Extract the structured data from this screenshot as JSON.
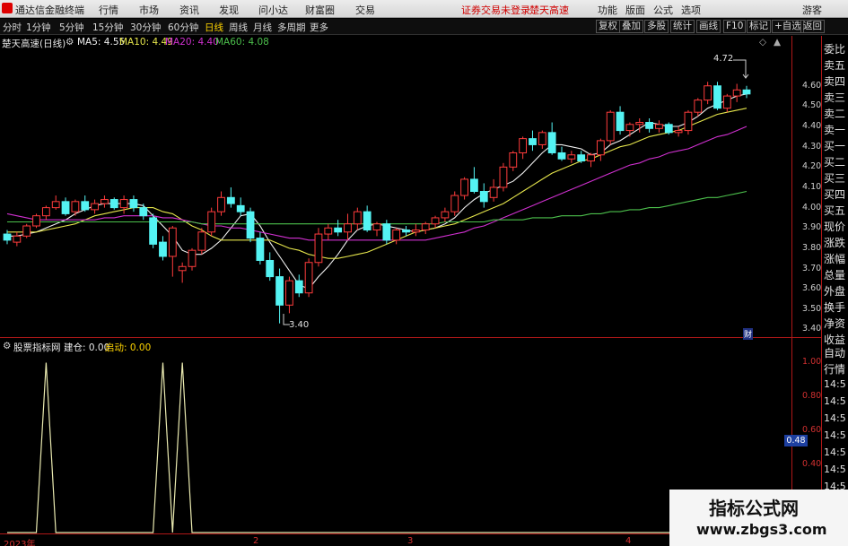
{
  "menubar": {
    "app_title": "通达信金融终端",
    "items": [
      "行情",
      "市场",
      "资讯",
      "发现",
      "问小达",
      "财富圈",
      "交易"
    ],
    "warning": "证券交易未登录",
    "stock": "楚天高速",
    "right_items": [
      "功能",
      "版面",
      "公式",
      "选项"
    ],
    "user": "游客"
  },
  "toolbar": {
    "periods": [
      "分时",
      "1分钟",
      "5分钟",
      "15分钟",
      "30分钟",
      "60分钟",
      "日线",
      "周线",
      "月线",
      "多周期",
      "更多"
    ],
    "selected_period": "日线",
    "buttons": [
      "复权",
      "叠加",
      "多股",
      "统计",
      "画线",
      "F10",
      "标记",
      "+自选",
      "返回"
    ]
  },
  "main_chart": {
    "stock_name": "楚天高速",
    "period": "(日线)",
    "ma5": "MA5: 4.55",
    "ma10": "MA10: 4.49",
    "ma20": "MA20: 4.40",
    "ma60": "MA60: 4.08",
    "high_label": "4.72",
    "low_label": "3.40",
    "cai_icon": "财"
  },
  "sub_chart": {
    "name": "股票指标网",
    "build": "建仓: 0.00",
    "start": "启动: 0.00",
    "current_value": "0.48"
  },
  "right_panel": {
    "labels": [
      "委比",
      "卖五",
      "卖四",
      "卖三",
      "卖二",
      "卖一",
      "买一",
      "买二",
      "买三",
      "买四",
      "买五",
      "现价",
      "涨跌",
      "涨幅",
      "总量",
      "外盘",
      "换手",
      "净资",
      "收益"
    ],
    "lower_labels": [
      "自动",
      "行情"
    ],
    "times": [
      "14:5",
      "14:5",
      "14:5",
      "14:5",
      "14:5",
      "14:5",
      "14:5",
      "14:5",
      "14:5",
      "14:5"
    ]
  },
  "x_labels": [
    "2023年",
    "2",
    "3",
    "4"
  ],
  "watermark": {
    "line1": "指标公式网",
    "line2": "www.zbgs3.com"
  },
  "colors": {
    "up": "#ff3c3c",
    "down": "#54f3f3",
    "ma5": "#f0f0f0",
    "ma10": "#e6e64c",
    "ma20": "#d030d0",
    "ma60": "#4cc04c",
    "sub_line": "#eaeab0"
  },
  "chart_data": [
    {
      "type": "candlestick",
      "title": "楚天高速 (日线)",
      "y_ticks": [
        4.6,
        4.5,
        4.4,
        4.3,
        4.2,
        4.1,
        4.0,
        3.9,
        3.8,
        3.7,
        3.6,
        3.5,
        3.4
      ],
      "ylim": [
        3.38,
        4.78
      ],
      "ohlc": [
        [
          3.87,
          3.89,
          3.82,
          3.84
        ],
        [
          3.83,
          3.88,
          3.81,
          3.86
        ],
        [
          3.86,
          3.92,
          3.85,
          3.91
        ],
        [
          3.91,
          3.97,
          3.9,
          3.96
        ],
        [
          3.96,
          4.01,
          3.94,
          4.0
        ],
        [
          4.0,
          4.06,
          3.99,
          4.03
        ],
        [
          4.03,
          4.05,
          3.96,
          3.97
        ],
        [
          3.98,
          4.04,
          3.96,
          4.03
        ],
        [
          4.03,
          4.06,
          3.98,
          3.99
        ],
        [
          3.99,
          4.04,
          3.97,
          4.02
        ],
        [
          4.02,
          4.06,
          4.0,
          4.04
        ],
        [
          4.04,
          4.05,
          3.99,
          4.0
        ],
        [
          4.0,
          4.06,
          3.97,
          4.04
        ],
        [
          4.04,
          4.06,
          3.98,
          4.0
        ],
        [
          4.0,
          4.02,
          3.94,
          3.96
        ],
        [
          3.95,
          3.97,
          3.8,
          3.82
        ],
        [
          3.83,
          3.86,
          3.74,
          3.76
        ],
        [
          3.76,
          3.91,
          3.66,
          3.9
        ],
        [
          3.69,
          3.73,
          3.63,
          3.71
        ],
        [
          3.71,
          3.8,
          3.69,
          3.79
        ],
        [
          3.79,
          3.9,
          3.77,
          3.88
        ],
        [
          3.88,
          4.0,
          3.86,
          3.98
        ],
        [
          3.98,
          4.08,
          3.96,
          4.05
        ],
        [
          4.05,
          4.1,
          4.0,
          4.02
        ],
        [
          4.01,
          4.05,
          3.96,
          3.98
        ],
        [
          3.98,
          4.0,
          3.83,
          3.85
        ],
        [
          3.85,
          3.88,
          3.72,
          3.74
        ],
        [
          3.74,
          3.78,
          3.64,
          3.66
        ],
        [
          3.66,
          3.7,
          3.43,
          3.52
        ],
        [
          3.52,
          3.66,
          3.48,
          3.64
        ],
        [
          3.64,
          3.67,
          3.56,
          3.58
        ],
        [
          3.58,
          3.75,
          3.56,
          3.73
        ],
        [
          3.73,
          3.9,
          3.71,
          3.87
        ],
        [
          3.87,
          3.92,
          3.84,
          3.9
        ],
        [
          3.9,
          3.94,
          3.86,
          3.88
        ],
        [
          3.88,
          3.97,
          3.84,
          3.92
        ],
        [
          3.92,
          4.0,
          3.89,
          3.98
        ],
        [
          3.98,
          4.01,
          3.88,
          3.89
        ],
        [
          3.89,
          3.93,
          3.86,
          3.92
        ],
        [
          3.92,
          3.94,
          3.82,
          3.84
        ],
        [
          3.84,
          3.9,
          3.82,
          3.89
        ],
        [
          3.89,
          3.91,
          3.86,
          3.88
        ],
        [
          3.88,
          3.92,
          3.86,
          3.89
        ],
        [
          3.89,
          3.93,
          3.87,
          3.92
        ],
        [
          3.92,
          3.96,
          3.9,
          3.95
        ],
        [
          3.95,
          4.0,
          3.93,
          3.98
        ],
        [
          3.98,
          4.08,
          3.96,
          4.06
        ],
        [
          4.06,
          4.15,
          4.04,
          4.14
        ],
        [
          4.14,
          4.2,
          4.07,
          4.08
        ],
        [
          4.08,
          4.12,
          4.0,
          4.03
        ],
        [
          4.05,
          4.14,
          4.03,
          4.1
        ],
        [
          4.1,
          4.22,
          4.08,
          4.2
        ],
        [
          4.2,
          4.28,
          4.18,
          4.27
        ],
        [
          4.27,
          4.35,
          4.24,
          4.34
        ],
        [
          4.34,
          4.38,
          4.28,
          4.31
        ],
        [
          4.31,
          4.38,
          4.29,
          4.37
        ],
        [
          4.37,
          4.42,
          4.26,
          4.27
        ],
        [
          4.27,
          4.3,
          4.23,
          4.24
        ],
        [
          4.24,
          4.28,
          4.22,
          4.26
        ],
        [
          4.26,
          4.28,
          4.22,
          4.23
        ],
        [
          4.23,
          4.27,
          4.2,
          4.26
        ],
        [
          4.26,
          4.34,
          4.23,
          4.33
        ],
        [
          4.33,
          4.48,
          4.31,
          4.47
        ],
        [
          4.47,
          4.5,
          4.36,
          4.38
        ],
        [
          4.38,
          4.42,
          4.35,
          4.41
        ],
        [
          4.41,
          4.44,
          4.37,
          4.42
        ],
        [
          4.42,
          4.44,
          4.37,
          4.39
        ],
        [
          4.39,
          4.43,
          4.37,
          4.41
        ],
        [
          4.41,
          4.42,
          4.36,
          4.37
        ],
        [
          4.37,
          4.4,
          4.35,
          4.38
        ],
        [
          4.38,
          4.48,
          4.36,
          4.47
        ],
        [
          4.47,
          4.54,
          4.45,
          4.53
        ],
        [
          4.53,
          4.62,
          4.51,
          4.6
        ],
        [
          4.6,
          4.62,
          4.48,
          4.49
        ],
        [
          4.49,
          4.56,
          4.47,
          4.55
        ],
        [
          4.55,
          4.61,
          4.52,
          4.58
        ],
        [
          4.58,
          4.6,
          4.54,
          4.56
        ]
      ],
      "series": [
        {
          "name": "MA5",
          "color": "#f0f0f0",
          "values": [
            3.86,
            3.86,
            3.87,
            3.88,
            3.9,
            3.92,
            3.94,
            3.97,
            3.99,
            4.01,
            4.02,
            4.02,
            4.02,
            4.02,
            4.01,
            3.96,
            3.91,
            3.86,
            3.79,
            3.77,
            3.77,
            3.8,
            3.84,
            3.9,
            3.96,
            3.97,
            3.91,
            3.83,
            3.76,
            3.69,
            3.62,
            3.6,
            3.66,
            3.71,
            3.77,
            3.84,
            3.89,
            3.91,
            3.92,
            3.91,
            3.9,
            3.89,
            3.88,
            3.89,
            3.9,
            3.92,
            3.95,
            4.0,
            4.04,
            4.07,
            4.09,
            4.11,
            4.13,
            4.17,
            4.22,
            4.27,
            4.31,
            4.31,
            4.3,
            4.29,
            4.26,
            4.27,
            4.31,
            4.33,
            4.36,
            4.39,
            4.42,
            4.41,
            4.4,
            4.4,
            4.42,
            4.45,
            4.49,
            4.51,
            4.53,
            4.55,
            4.56
          ]
        },
        {
          "name": "MA10",
          "color": "#e6e64c",
          "values": [
            3.88,
            3.88,
            3.88,
            3.88,
            3.89,
            3.9,
            3.91,
            3.92,
            3.94,
            3.96,
            3.97,
            3.98,
            3.99,
            4.0,
            4.0,
            4.0,
            3.98,
            3.97,
            3.94,
            3.91,
            3.89,
            3.86,
            3.84,
            3.84,
            3.84,
            3.84,
            3.84,
            3.84,
            3.82,
            3.8,
            3.79,
            3.77,
            3.76,
            3.75,
            3.75,
            3.76,
            3.77,
            3.78,
            3.8,
            3.82,
            3.84,
            3.86,
            3.88,
            3.89,
            3.9,
            3.91,
            3.92,
            3.94,
            3.96,
            3.98,
            4.0,
            4.02,
            4.05,
            4.08,
            4.11,
            4.14,
            4.17,
            4.19,
            4.21,
            4.23,
            4.24,
            4.26,
            4.28,
            4.3,
            4.31,
            4.33,
            4.35,
            4.36,
            4.37,
            4.38,
            4.4,
            4.42,
            4.44,
            4.46,
            4.47,
            4.48,
            4.49
          ]
        },
        {
          "name": "MA20",
          "color": "#d030d0",
          "values": [
            3.97,
            3.96,
            3.95,
            3.94,
            3.94,
            3.94,
            3.94,
            3.94,
            3.94,
            3.94,
            3.95,
            3.95,
            3.96,
            3.96,
            3.96,
            3.96,
            3.95,
            3.95,
            3.94,
            3.93,
            3.92,
            3.91,
            3.91,
            3.9,
            3.9,
            3.89,
            3.88,
            3.87,
            3.86,
            3.85,
            3.85,
            3.84,
            3.84,
            3.84,
            3.84,
            3.84,
            3.84,
            3.84,
            3.84,
            3.84,
            3.84,
            3.84,
            3.84,
            3.84,
            3.85,
            3.86,
            3.87,
            3.88,
            3.9,
            3.91,
            3.93,
            3.95,
            3.97,
            3.99,
            4.01,
            4.03,
            4.05,
            4.07,
            4.09,
            4.11,
            4.13,
            4.15,
            4.17,
            4.19,
            4.21,
            4.22,
            4.24,
            4.25,
            4.27,
            4.28,
            4.29,
            4.31,
            4.33,
            4.35,
            4.36,
            4.38,
            4.4
          ]
        },
        {
          "name": "MA60",
          "color": "#4cc04c",
          "values": [
            3.93,
            3.93,
            3.93,
            3.93,
            3.93,
            3.93,
            3.93,
            3.93,
            3.93,
            3.93,
            3.93,
            3.93,
            3.93,
            3.93,
            3.93,
            3.93,
            3.93,
            3.93,
            3.93,
            3.93,
            3.92,
            3.92,
            3.92,
            3.92,
            3.92,
            3.92,
            3.92,
            3.92,
            3.92,
            3.92,
            3.92,
            3.92,
            3.92,
            3.92,
            3.92,
            3.92,
            3.92,
            3.92,
            3.92,
            3.92,
            3.92,
            3.92,
            3.92,
            3.92,
            3.92,
            3.93,
            3.93,
            3.93,
            3.93,
            3.93,
            3.94,
            3.94,
            3.94,
            3.94,
            3.95,
            3.95,
            3.95,
            3.96,
            3.96,
            3.96,
            3.97,
            3.97,
            3.98,
            3.98,
            3.99,
            3.99,
            4.0,
            4.0,
            4.01,
            4.02,
            4.03,
            4.04,
            4.05,
            4.05,
            4.06,
            4.07,
            4.08
          ]
        }
      ]
    },
    {
      "type": "line",
      "title": "股票指标网",
      "y_ticks": [
        1.0,
        0.8,
        0.6,
        0.4,
        0.2
      ],
      "ylim": [
        0,
        1.05
      ],
      "series": [
        {
          "name": "建仓",
          "values": [
            0,
            0,
            0,
            0,
            1,
            0,
            0,
            0,
            0,
            0,
            0,
            0,
            0,
            0,
            0,
            0,
            1,
            0,
            1,
            0,
            0,
            0,
            0,
            0,
            0,
            0,
            0,
            0,
            0,
            0,
            0,
            0,
            0,
            0,
            0,
            0,
            0,
            0,
            0,
            0,
            0,
            0,
            0,
            0,
            0,
            0,
            0,
            0,
            0,
            0,
            0,
            0,
            0,
            0,
            0,
            0,
            0,
            0,
            0,
            0,
            0,
            0,
            0,
            0,
            0,
            0,
            0,
            0,
            0,
            0,
            0,
            0,
            0,
            0,
            0,
            0,
            0
          ]
        }
      ]
    }
  ]
}
